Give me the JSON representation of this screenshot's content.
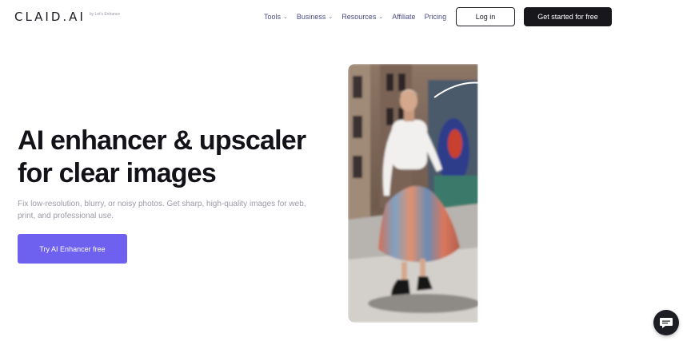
{
  "header": {
    "logo": "CLAID.AI",
    "logo_sub": "by Let's Enhance",
    "nav": [
      {
        "label": "Tools",
        "has_dropdown": true
      },
      {
        "label": "Business",
        "has_dropdown": true
      },
      {
        "label": "Resources",
        "has_dropdown": true
      },
      {
        "label": "Affiliate",
        "has_dropdown": false
      },
      {
        "label": "Pricing",
        "has_dropdown": false
      }
    ],
    "login_label": "Log in",
    "cta_label": "Get started for free"
  },
  "hero": {
    "title_line1": "AI enhancer & upscaler",
    "title_line2": "for clear images",
    "description": "Fix low-resolution, blurry, or noisy photos. Get sharp, high-quality images for web, print, and professional use.",
    "cta_label": "Try AI Enhancer free"
  },
  "icons": {
    "chevron": "chevron-down-icon",
    "chat": "chat-bubble-icon",
    "arrow": "curved-arrow-icon"
  },
  "colors": {
    "accent": "#6e61f0",
    "dark": "#17171c",
    "nav_text": "#4b4f83",
    "muted_text": "#9b9ba6"
  }
}
